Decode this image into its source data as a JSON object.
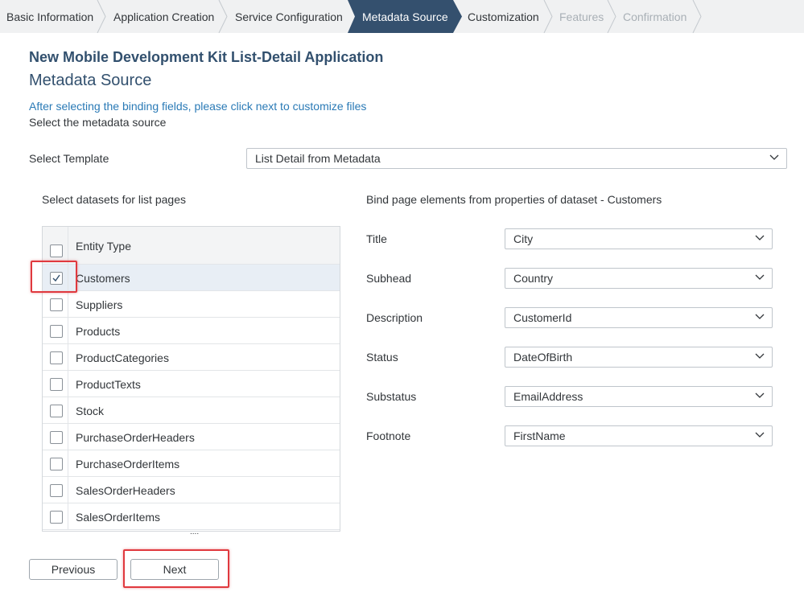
{
  "wizard": {
    "steps": [
      {
        "label": "Basic Information",
        "state": "done"
      },
      {
        "label": "Application Creation",
        "state": "done"
      },
      {
        "label": "Service Configuration",
        "state": "done"
      },
      {
        "label": "Metadata Source",
        "state": "active"
      },
      {
        "label": "Customization",
        "state": "todo"
      },
      {
        "label": "Features",
        "state": "disabled"
      },
      {
        "label": "Confirmation",
        "state": "disabled"
      }
    ]
  },
  "header": {
    "app_title": "New Mobile Development Kit List-Detail Application",
    "page_title": "Metadata Source",
    "hint": "After selecting the binding fields, please click next to customize files",
    "subtitle": "Select the metadata source"
  },
  "template": {
    "label": "Select Template",
    "value": "List Detail from Metadata"
  },
  "datasets": {
    "label": "Select datasets for list pages",
    "column_header": "Entity Type",
    "more": "....",
    "rows": [
      {
        "name": "Customers",
        "checked": true
      },
      {
        "name": "Suppliers",
        "checked": false
      },
      {
        "name": "Products",
        "checked": false
      },
      {
        "name": "ProductCategories",
        "checked": false
      },
      {
        "name": "ProductTexts",
        "checked": false
      },
      {
        "name": "Stock",
        "checked": false
      },
      {
        "name": "PurchaseOrderHeaders",
        "checked": false
      },
      {
        "name": "PurchaseOrderItems",
        "checked": false
      },
      {
        "name": "SalesOrderHeaders",
        "checked": false
      },
      {
        "name": "SalesOrderItems",
        "checked": false
      }
    ]
  },
  "binding": {
    "label": "Bind page elements from properties of dataset - Customers",
    "fields": [
      {
        "label": "Title",
        "value": "City"
      },
      {
        "label": "Subhead",
        "value": "Country"
      },
      {
        "label": "Description",
        "value": "CustomerId"
      },
      {
        "label": "Status",
        "value": "DateOfBirth"
      },
      {
        "label": "Substatus",
        "value": "EmailAddress"
      },
      {
        "label": "Footnote",
        "value": "FirstName"
      }
    ]
  },
  "buttons": {
    "previous": "Previous",
    "next": "Next"
  },
  "colors": {
    "active_step": "#34506e",
    "highlight": "#e0393e",
    "link_text": "#2a7ab6"
  },
  "icons": {
    "dropdown": "chevron-down-icon",
    "check": "check-icon"
  }
}
